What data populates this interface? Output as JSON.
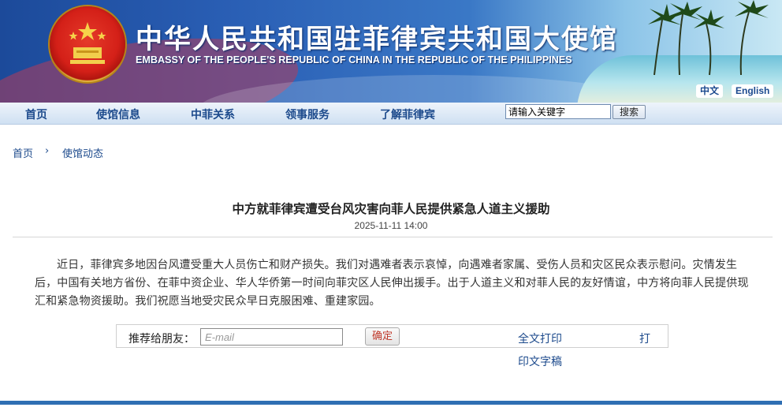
{
  "header": {
    "title_cn": "中华人民共和国驻菲律宾共和国大使馆",
    "title_en": "EMBASSY OF THE PEOPLE'S REPUBLIC OF CHINA IN THE REPUBLIC OF THE PHILIPPINES",
    "lang_zh": "中文",
    "lang_en": "English",
    "emblem_icon": "national-emblem-icon"
  },
  "nav": {
    "items": [
      {
        "label": "首页"
      },
      {
        "label": "使馆信息"
      },
      {
        "label": "中菲关系"
      },
      {
        "label": "领事服务"
      },
      {
        "label": "了解菲律宾"
      }
    ],
    "search_value": "请输入关键字",
    "search_button": "搜索"
  },
  "breadcrumb": {
    "home": "首页",
    "separator": "›",
    "current": "使馆动态"
  },
  "article": {
    "title": "中方就菲律宾遭受台风灾害向菲人民提供紧急人道主义援助",
    "date": "2025-11-11 14:00",
    "body": "近日，菲律宾多地因台风遭受重大人员伤亡和财产损失。我们对遇难者表示哀悼，向遇难者家属、受伤人员和灾区民众表示慰问。灾情发生后，中国有关地方省份、在菲中资企业、华人华侨第一时间向菲灾区人民伸出援手。出于人道主义和对菲人民的友好情谊，中方将向菲人民提供现汇和紧急物资援助。我们祝愿当地受灾民众早日克服困难、重建家园。"
  },
  "share": {
    "label": "推荐给朋友：",
    "email_placeholder": "E-mail",
    "confirm_button": "确定",
    "print_full": "全文打印",
    "print_draft_a": "打",
    "print_draft_b": "印文字稿"
  },
  "colors": {
    "nav_text": "#1c4a8c",
    "banner_blue": "#2a5fb5",
    "footer_bar": "#2f6fb3"
  }
}
